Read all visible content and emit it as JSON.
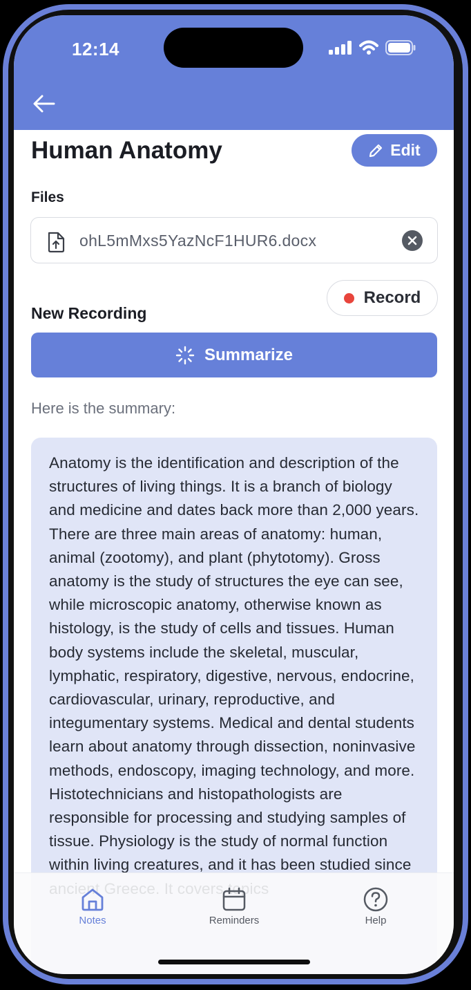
{
  "status_bar": {
    "time": "12:14"
  },
  "header": {
    "back_icon": "arrow-left-icon"
  },
  "note": {
    "title": "Human Anatomy",
    "edit_label": "Edit",
    "files_label": "Files",
    "file_name": "ohL5mMxs5YazNcF1HUR6.docx",
    "recording_label": "New Recording",
    "record_label": "Record",
    "summarize_label": "Summarize",
    "summary_intro": "Here is the summary:",
    "summary_text": "Anatomy is the identification and description of the structures of living things. It is a branch of biology and medicine and dates back more than 2,000 years. There are three main areas of anatomy: human, animal (zootomy), and plant (phytotomy). Gross anatomy is the study of structures the eye can see, while microscopic anatomy, otherwise known as histology, is the study of cells and tissues. Human body systems include the skeletal, muscular, lymphatic, respiratory, digestive, nervous, endocrine, cardiovascular, urinary, reproductive, and integumentary systems. Medical and dental students learn about anatomy through dissection, noninvasive methods, endoscopy, imaging technology, and more. Histotechnicians and histopathologists are responsible for processing and studying samples of tissue. Physiology is the study of normal function within living creatures, and it has been studied since ancient Greece. It covers topics"
  },
  "tabs": [
    {
      "label": "Notes",
      "icon": "home-icon",
      "active": true
    },
    {
      "label": "Reminders",
      "icon": "calendar-icon",
      "active": false
    },
    {
      "label": "Help",
      "icon": "help-circle-icon",
      "active": false
    }
  ],
  "colors": {
    "accent": "#6680d9",
    "record": "#e8453c",
    "summary_bg": "#e0e5f7"
  }
}
